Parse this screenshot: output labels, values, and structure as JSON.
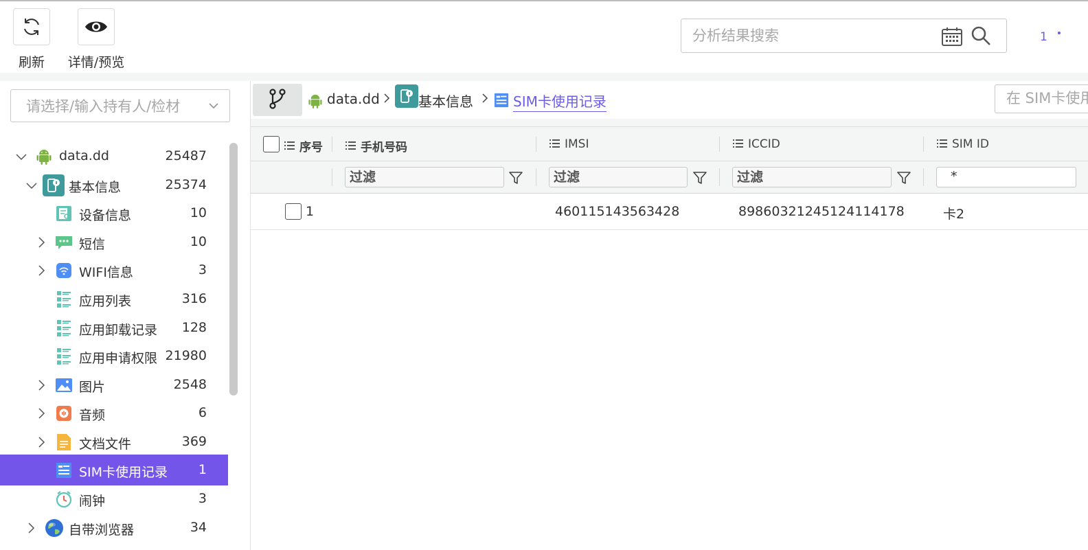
{
  "toolbar": {
    "refresh_label": "刷新",
    "details_label": "详情/预览"
  },
  "search": {
    "placeholder": "分析结果搜索",
    "page_indicator": "1"
  },
  "sidebar": {
    "owner_placeholder": "请选择/输入持有人/检材",
    "tree": [
      {
        "label": "data.dd",
        "count": "25487",
        "icon": "android-icon",
        "expanded": true
      },
      {
        "label": "基本信息",
        "count": "25374",
        "icon": "basic-info-icon",
        "expanded": true
      },
      {
        "label": "设备信息",
        "count": "10",
        "icon": "device-info-icon"
      },
      {
        "label": "短信",
        "count": "10",
        "icon": "sms-icon",
        "expandable": true
      },
      {
        "label": "WIFI信息",
        "count": "3",
        "icon": "wifi-icon",
        "expandable": true
      },
      {
        "label": "应用列表",
        "count": "316",
        "icon": "list-icon"
      },
      {
        "label": "应用卸载记录",
        "count": "128",
        "icon": "list-icon"
      },
      {
        "label": "应用申请权限",
        "count": "21980",
        "icon": "list-icon"
      },
      {
        "label": "图片",
        "count": "2548",
        "icon": "image-icon",
        "expandable": true
      },
      {
        "label": "音频",
        "count": "6",
        "icon": "audio-icon",
        "expandable": true
      },
      {
        "label": "文档文件",
        "count": "369",
        "icon": "document-icon",
        "expandable": true
      },
      {
        "label": "SIM卡使用记录",
        "count": "1",
        "icon": "sim-record-icon",
        "selected": true
      },
      {
        "label": "闹钟",
        "count": "3",
        "icon": "clock-icon"
      },
      {
        "label": "自带浏览器",
        "count": "34",
        "icon": "browser-icon",
        "expandable": true
      }
    ]
  },
  "breadcrumb": {
    "items": [
      "data.dd",
      "基本信息",
      "SIM卡使用记录"
    ],
    "search_placeholder": "在 SIM卡使用记录中搜索"
  },
  "table": {
    "columns": [
      "序号",
      "手机号码",
      "IMSI",
      "ICCID",
      "SIM ID"
    ],
    "filter_placeholder": "过滤",
    "sim_id_filter_value": "*",
    "rows": [
      {
        "index": "1",
        "phone": "",
        "imsi": "460115143563428",
        "iccid": "89860321245124114178",
        "sim_id": "卡2"
      }
    ]
  },
  "colors": {
    "accent": "#7355e9",
    "link": "#6b5ce7",
    "android": "#7cb342"
  }
}
